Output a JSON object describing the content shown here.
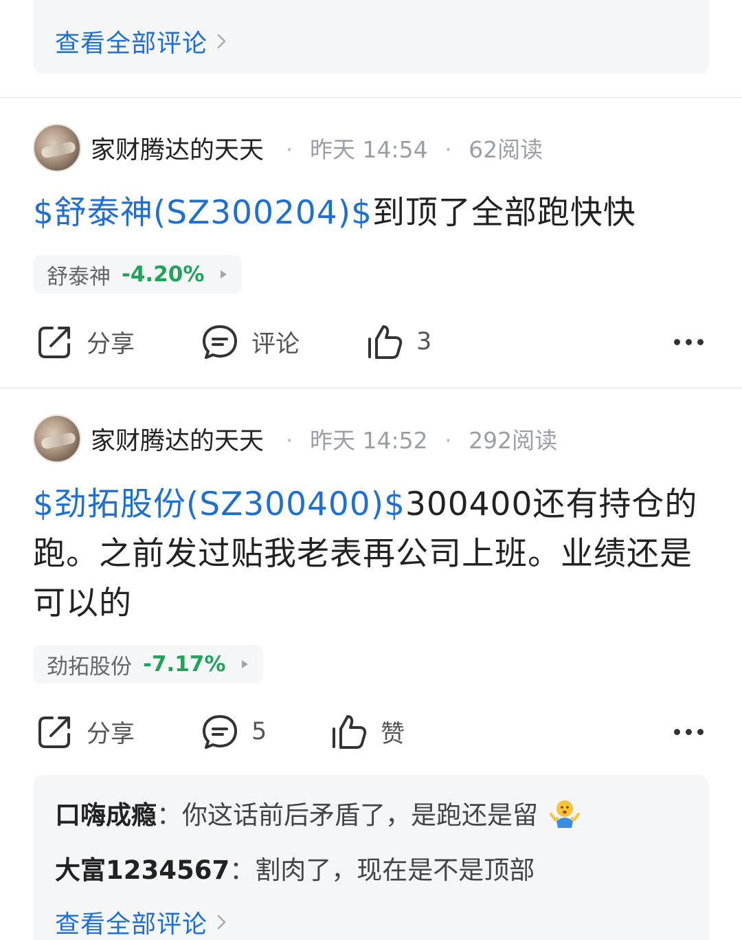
{
  "previous_post": {
    "view_all_label": "查看全部评论"
  },
  "posts": [
    {
      "author": "家财腾达的天天",
      "time": "昨天 14:54",
      "reads": "62阅读",
      "stock_link": "$舒泰神(SZ300204)$",
      "text": "到顶了全部跑快快",
      "chip": {
        "name": "舒泰神",
        "change": "-4.20%"
      },
      "actions": {
        "share": "分享",
        "comment": "评论",
        "like": "3"
      }
    },
    {
      "author": "家财腾达的天天",
      "time": "昨天 14:52",
      "reads": "292阅读",
      "stock_link": "$劲拓股份(SZ300400)$",
      "text": "300400还有持仓的跑。之前发过贴我老表再公司上班。业绩还是可以的",
      "chip": {
        "name": "劲拓股份",
        "change": "-7.17%"
      },
      "actions": {
        "share": "分享",
        "comment": "5",
        "like": "赞"
      },
      "comments": [
        {
          "user": "口嗨成瘾",
          "sep": "：",
          "text": "你这话前后矛盾了，是跑还是留",
          "emoji": "shrug-emoji"
        },
        {
          "user": "大富1234567",
          "sep": "：",
          "text": "割肉了，现在是不是顶部"
        }
      ],
      "view_all_label": "查看全部评论"
    }
  ],
  "colors": {
    "link": "#1f6fd1",
    "down": "#22a35a",
    "panel": "#f5f6f8"
  }
}
